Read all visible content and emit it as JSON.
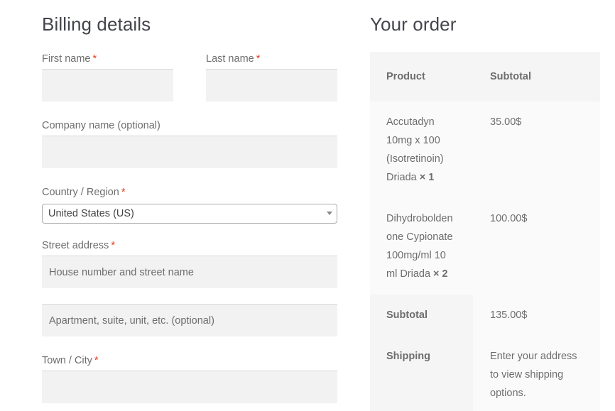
{
  "billing": {
    "title": "Billing details",
    "required_marker": "*",
    "first_name": {
      "label": "First name",
      "value": "",
      "placeholder": ""
    },
    "last_name": {
      "label": "Last name",
      "value": "",
      "placeholder": ""
    },
    "company": {
      "label": "Company name (optional)",
      "value": "",
      "placeholder": ""
    },
    "country": {
      "label": "Country / Region",
      "selected": "United States (US)"
    },
    "street": {
      "label": "Street address",
      "line1_placeholder": "House number and street name",
      "line2_placeholder": "Apartment, suite, unit, etc. (optional)"
    },
    "city": {
      "label": "Town / City",
      "value": "",
      "placeholder": ""
    }
  },
  "order": {
    "title": "Your order",
    "headers": {
      "product": "Product",
      "subtotal": "Subtotal"
    },
    "items": [
      {
        "lines": [
          "Accutadyn",
          "10mg x 100",
          "(Isotretinoin)",
          "Driada"
        ],
        "quantity": "× 1",
        "subtotal": "35.00$"
      },
      {
        "lines": [
          "Dihydrobolden",
          "one Cypionate",
          "100mg/ml 10",
          "ml Driada"
        ],
        "quantity": "× 2",
        "subtotal": "100.00$"
      }
    ],
    "subtotal": {
      "label": "Subtotal",
      "value": "135.00$"
    },
    "shipping": {
      "label": "Shipping",
      "lines": [
        "Enter your address",
        "to view shipping",
        "options."
      ]
    }
  },
  "colors": {
    "required": "#e2401c",
    "input_bg": "#f2f2f2",
    "table_dark": "#f5f5f5",
    "table_light": "#fafafa",
    "text": "#43454b",
    "muted": "#6d6d6d"
  }
}
